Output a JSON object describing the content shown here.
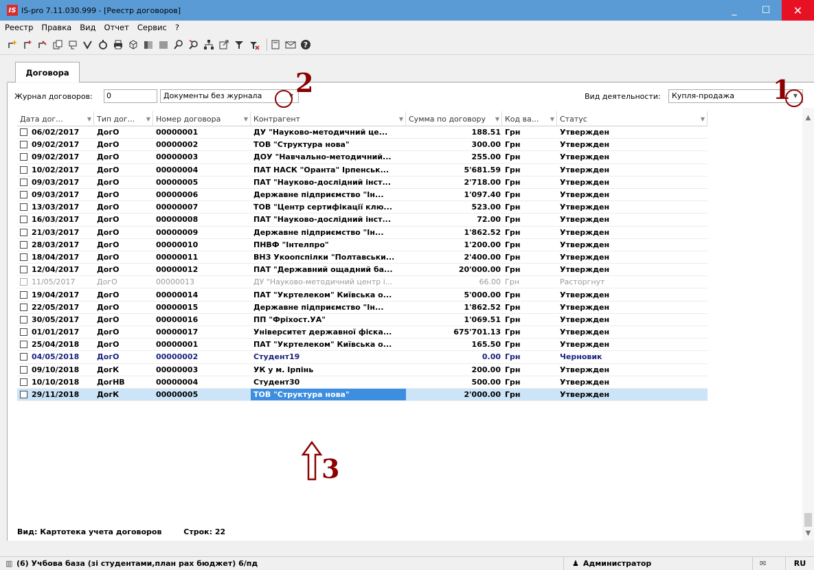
{
  "window": {
    "logo": "IS",
    "title": "IS-pro 7.11.030.999 - [Реестр договоров]",
    "minimize": "_",
    "maximize": "☐",
    "close": "✕"
  },
  "menu": [
    "Реестр",
    "Правка",
    "Вид",
    "Отчет",
    "Сервис",
    "?"
  ],
  "toolbar_icons": [
    "add-icon",
    "add-copy-icon",
    "edit-icon",
    "copy-icon",
    "move-icon",
    "check-icon",
    "refresh-icon",
    "print-icon",
    "package-icon",
    "panel-icon",
    "panel-gray-icon",
    "find-icon",
    "find-next-icon",
    "tree-icon",
    "export-icon",
    "filter-icon",
    "clear-filter-icon",
    "note-icon",
    "mail-icon",
    "help-icon"
  ],
  "tabs": [
    {
      "label": "Договора"
    }
  ],
  "filters": {
    "journal_label": "Журнал договоров:",
    "journal_number": "0",
    "journal_value": "Документы без журнала",
    "activity_label": "Вид деятельности:",
    "activity_value": "Купля-продажа"
  },
  "columns": [
    "Дата дог...",
    "Тип дог...",
    "Номер договора",
    "Контрагент",
    "Сумма по договору",
    "Код ва...",
    "Статус"
  ],
  "rows": [
    {
      "date": "06/02/2017",
      "type": "ДогО",
      "number": "00000001",
      "party": "ДУ \"Науково-методичний це...",
      "sum": "188.51",
      "cur": "Грн",
      "status": "Утвержден",
      "state": "normal"
    },
    {
      "date": "09/02/2017",
      "type": "ДогО",
      "number": "00000002",
      "party": "ТОВ \"Структура нова\"",
      "sum": "300.00",
      "cur": "Грн",
      "status": "Утвержден",
      "state": "normal"
    },
    {
      "date": "09/02/2017",
      "type": "ДогО",
      "number": "00000003",
      "party": "ДОУ \"Навчально-методичний...",
      "sum": "255.00",
      "cur": "Грн",
      "status": "Утвержден",
      "state": "normal"
    },
    {
      "date": "10/02/2017",
      "type": "ДогО",
      "number": "00000004",
      "party": "ПАТ НАСК \"Оранта\" Ірпенськ...",
      "sum": "5'681.59",
      "cur": "Грн",
      "status": "Утвержден",
      "state": "normal"
    },
    {
      "date": "09/03/2017",
      "type": "ДогО",
      "number": "00000005",
      "party": "ПАТ \"Науково-дослідний інст...",
      "sum": "2'718.00",
      "cur": "Грн",
      "status": "Утвержден",
      "state": "normal"
    },
    {
      "date": "09/03/2017",
      "type": "ДогО",
      "number": "00000006",
      "party": "Державне підприємство \"Ін...",
      "sum": "1'097.40",
      "cur": "Грн",
      "status": "Утвержден",
      "state": "normal"
    },
    {
      "date": "13/03/2017",
      "type": "ДогО",
      "number": "00000007",
      "party": "ТОВ \"Центр сертифікації клю...",
      "sum": "523.00",
      "cur": "Грн",
      "status": "Утвержден",
      "state": "normal"
    },
    {
      "date": "16/03/2017",
      "type": "ДогО",
      "number": "00000008",
      "party": "ПАТ \"Науково-дослідний інст...",
      "sum": "72.00",
      "cur": "Грн",
      "status": "Утвержден",
      "state": "normal"
    },
    {
      "date": "21/03/2017",
      "type": "ДогО",
      "number": "00000009",
      "party": "Державне підприємство \"Ін...",
      "sum": "1'862.52",
      "cur": "Грн",
      "status": "Утвержден",
      "state": "normal"
    },
    {
      "date": "28/03/2017",
      "type": "ДогО",
      "number": "00000010",
      "party": "ПНВФ \"Інтелпро\"",
      "sum": "1'200.00",
      "cur": "Грн",
      "status": "Утвержден",
      "state": "normal"
    },
    {
      "date": "18/04/2017",
      "type": "ДогО",
      "number": "00000011",
      "party": "ВНЗ Укоопспілки \"Полтавськи...",
      "sum": "2'400.00",
      "cur": "Грн",
      "status": "Утвержден",
      "state": "normal"
    },
    {
      "date": "12/04/2017",
      "type": "ДогО",
      "number": "00000012",
      "party": "ПАТ  \"Державний ощадний ба...",
      "sum": "20'000.00",
      "cur": "Грн",
      "status": "Утвержден",
      "state": "normal"
    },
    {
      "date": "11/05/2017",
      "type": "ДогО",
      "number": "00000013",
      "party": "ДУ \"Науково-методичний центр і...",
      "sum": "66.00",
      "cur": "Грн",
      "status": "Расторгнут",
      "state": "dim"
    },
    {
      "date": "19/04/2017",
      "type": "ДогО",
      "number": "00000014",
      "party": "ПАТ \"Укртелеком\" Київська о...",
      "sum": "5'000.00",
      "cur": "Грн",
      "status": "Утвержден",
      "state": "normal"
    },
    {
      "date": "22/05/2017",
      "type": "ДогО",
      "number": "00000015",
      "party": "Державне підприємство \"Ін...",
      "sum": "1'862.52",
      "cur": "Грн",
      "status": "Утвержден",
      "state": "normal"
    },
    {
      "date": "30/05/2017",
      "type": "ДогО",
      "number": "00000016",
      "party": "ПП \"Фріхост.УА\"",
      "sum": "1'069.51",
      "cur": "Грн",
      "status": "Утвержден",
      "state": "normal"
    },
    {
      "date": "01/01/2017",
      "type": "ДогО",
      "number": "00000017",
      "party": "Університет державної фіска...",
      "sum": "675'701.13",
      "cur": "Грн",
      "status": "Утвержден",
      "state": "normal"
    },
    {
      "date": "25/04/2018",
      "type": "ДогО",
      "number": "00000001",
      "party": "ПАТ \"Укртелеком\" Київська о...",
      "sum": "165.50",
      "cur": "Грн",
      "status": "Утвержден",
      "state": "normal"
    },
    {
      "date": "04/05/2018",
      "type": "ДогО",
      "number": "00000002",
      "party": "Студент19",
      "sum": "0.00",
      "cur": "Грн",
      "status": "Черновик",
      "state": "draft"
    },
    {
      "date": "09/10/2018",
      "type": "ДогК",
      "number": "00000003",
      "party": "УК у м. Ірпінь",
      "sum": "200.00",
      "cur": "Грн",
      "status": "Утвержден",
      "state": "normal"
    },
    {
      "date": "10/10/2018",
      "type": "ДогНВ",
      "number": "00000004",
      "party": "Студент30",
      "sum": "500.00",
      "cur": "Грн",
      "status": "Утвержден",
      "state": "normal"
    },
    {
      "date": "29/11/2018",
      "type": "ДогК",
      "number": "00000005",
      "party": "ТОВ \"Структура нова\"",
      "sum": "2'000.00",
      "cur": "Грн",
      "status": "Утвержден",
      "state": "selected"
    }
  ],
  "footer": {
    "view_label": "Вид: Картотека учета договоров",
    "rows_label": "Строк: 22"
  },
  "statusbar": {
    "database": "(6) Учбова база (зі студентами,план рах бюджет) 6/пд",
    "user": "Администратор",
    "lang": "RU"
  },
  "annotations": {
    "a1": "1",
    "a2": "2",
    "a3": "3"
  },
  "colors": {
    "titlebar": "#5b9bd5",
    "close": "#e81123",
    "selection": "#cce4f7",
    "selected_cell": "#3d8ee0",
    "draft": "#1a237e",
    "annotation": "#8b0000"
  }
}
